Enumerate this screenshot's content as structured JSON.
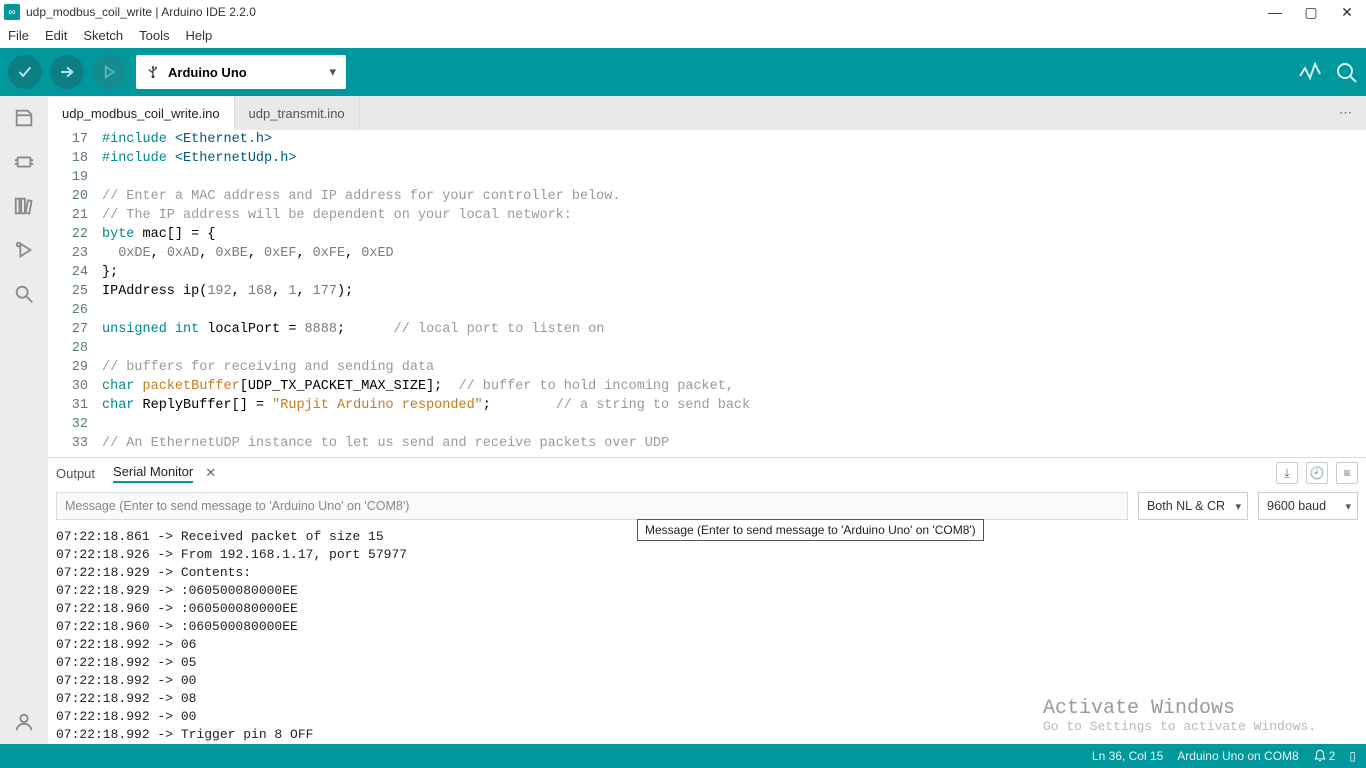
{
  "title": "udp_modbus_coil_write | Arduino IDE 2.2.0",
  "menu": [
    "File",
    "Edit",
    "Sketch",
    "Tools",
    "Help"
  ],
  "board_selected": "Arduino Uno",
  "tabs": [
    {
      "label": "udp_modbus_coil_write.ino",
      "active": true
    },
    {
      "label": "udp_transmit.ino",
      "active": false
    }
  ],
  "code_first_line": 17,
  "code_lines": [
    [
      [
        "kw",
        "#include "
      ],
      [
        "inc",
        "<Ethernet.h>"
      ]
    ],
    [
      [
        "kw",
        "#include "
      ],
      [
        "inc",
        "<EthernetUdp.h>"
      ]
    ],
    [],
    [
      [
        "com",
        "// Enter a MAC address and IP address for your controller below."
      ]
    ],
    [
      [
        "com",
        "// The IP address will be dependent on your local network:"
      ]
    ],
    [
      [
        "type",
        "byte"
      ],
      [
        "",
        " mac[] = {"
      ]
    ],
    [
      [
        "",
        "  "
      ],
      [
        "num",
        "0xDE"
      ],
      [
        "",
        ", "
      ],
      [
        "num",
        "0xAD"
      ],
      [
        "",
        ", "
      ],
      [
        "num",
        "0xBE"
      ],
      [
        "",
        ", "
      ],
      [
        "num",
        "0xEF"
      ],
      [
        "",
        ", "
      ],
      [
        "num",
        "0xFE"
      ],
      [
        "",
        ", "
      ],
      [
        "num",
        "0xED"
      ]
    ],
    [
      [
        "",
        "};"
      ]
    ],
    [
      [
        "",
        "IPAddress ip("
      ],
      [
        "num",
        "192"
      ],
      [
        "",
        ", "
      ],
      [
        "num",
        "168"
      ],
      [
        "",
        ", "
      ],
      [
        "num",
        "1"
      ],
      [
        "",
        ", "
      ],
      [
        "num",
        "177"
      ],
      [
        "",
        ");"
      ]
    ],
    [],
    [
      [
        "type",
        "unsigned int"
      ],
      [
        "",
        " localPort = "
      ],
      [
        "num",
        "8888"
      ],
      [
        "",
        ";      "
      ],
      [
        "com",
        "// local port to listen on"
      ]
    ],
    [],
    [
      [
        "com",
        "// buffers for receiving and sending data"
      ]
    ],
    [
      [
        "type",
        "char"
      ],
      [
        "",
        " "
      ],
      [
        "str",
        "packetBuffer"
      ],
      [
        "",
        "[UDP_TX_PACKET_MAX_SIZE];  "
      ],
      [
        "com",
        "// buffer to hold incoming packet,"
      ]
    ],
    [
      [
        "type",
        "char"
      ],
      [
        "",
        " ReplyBuffer[] = "
      ],
      [
        "str",
        "\"Rupjit Arduino responded\""
      ],
      [
        "",
        ";        "
      ],
      [
        "com",
        "// a string to send back"
      ]
    ],
    [],
    [
      [
        "com",
        "// An EthernetUDP instance to let us send and receive packets over UDP"
      ]
    ]
  ],
  "panel": {
    "tabs": {
      "output": "Output",
      "serial": "Serial Monitor"
    },
    "message_placeholder": "Message (Enter to send message to 'Arduino Uno' on 'COM8')",
    "tooltip": "Message (Enter to send message to 'Arduino Uno' on 'COM8')",
    "line_ending": "Both NL & CR",
    "baud": "9600 baud"
  },
  "serial_lines": [
    "07:22:18.861 -> Received packet of size 15",
    "07:22:18.926 -> From 192.168.1.17, port 57977",
    "07:22:18.929 -> Contents:",
    "07:22:18.929 -> :060500080000EE",
    "07:22:18.960 -> :060500080000EE",
    "07:22:18.960 -> :060500080000EE",
    "07:22:18.992 -> 06",
    "07:22:18.992 -> 05",
    "07:22:18.992 -> 00",
    "07:22:18.992 -> 08",
    "07:22:18.992 -> 00",
    "07:22:18.992 -> Trigger pin 8 OFF"
  ],
  "watermark": {
    "l1": "Activate Windows",
    "l2": "Go to Settings to activate Windows."
  },
  "status": {
    "pos": "Ln 36, Col 15",
    "board": "Arduino Uno on COM8",
    "notif": "2"
  }
}
